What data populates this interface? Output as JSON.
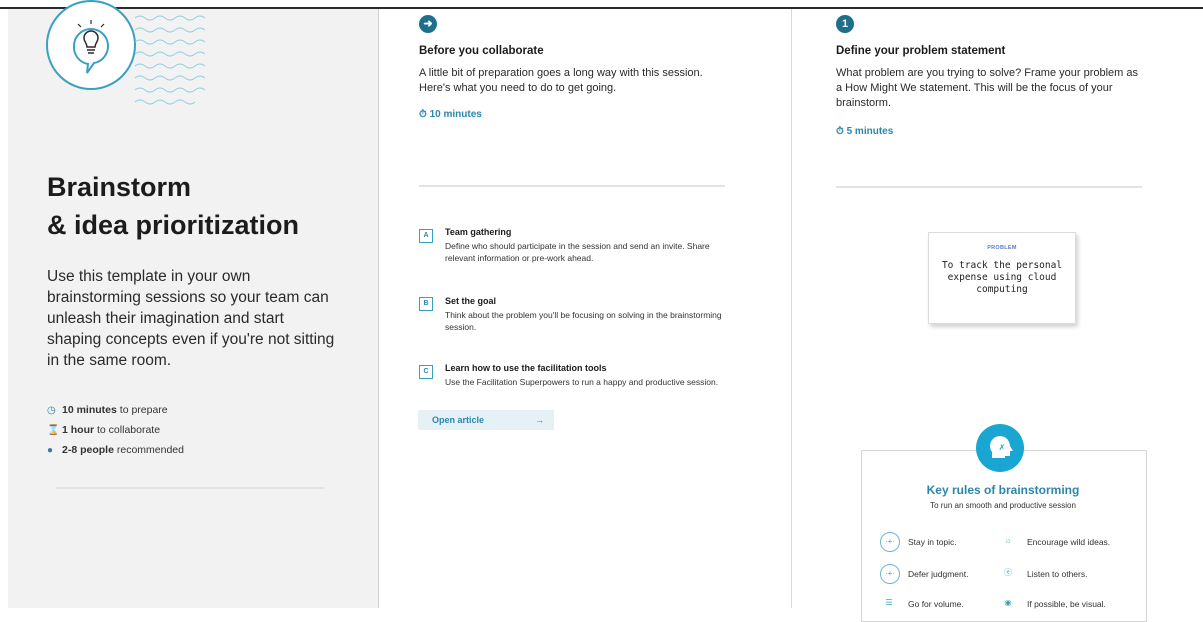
{
  "left": {
    "title_line1": "Brainstorm",
    "title_line2": "& idea prioritization",
    "description": "Use this template in your own brainstorming sessions so your team can unleash their imagination and start shaping concepts even if you're not sitting in the same room.",
    "meta": [
      {
        "icon": "clock-icon",
        "bold": "10 minutes",
        "text": " to prepare"
      },
      {
        "icon": "hourglass-icon",
        "bold": "1 hour",
        "text": " to collaborate"
      },
      {
        "icon": "person-icon",
        "bold": "2-8 people",
        "text": " recommended"
      }
    ]
  },
  "mid": {
    "step_icon": "arrow-right-icon",
    "heading": "Before you collaborate",
    "intro": "A little bit of preparation goes a long way with this session. Here's what you need to do to get going.",
    "time": "10 minutes",
    "items": [
      {
        "letter": "A",
        "title": "Team gathering",
        "text": "Define who should participate in the session and send an invite. Share relevant information or pre-work ahead."
      },
      {
        "letter": "B",
        "title": "Set the goal",
        "text": "Think about the problem you'll be focusing on solving in the brainstorming session."
      },
      {
        "letter": "C",
        "title": "Learn how to use the facilitation tools",
        "text": "Use the Facilitation Superpowers to run a happy and productive session."
      }
    ],
    "button_label": "Open article",
    "button_arrow": "→"
  },
  "right": {
    "step_number": "1",
    "heading": "Define your problem statement",
    "intro": "What problem are you trying to solve? Frame your problem as a How Might We statement. This will be the focus of your brainstorm.",
    "time": "5 minutes",
    "sticky_label": "PROBLEM",
    "sticky_text": "To track the personal expense using cloud computing",
    "rules_title": "Key rules of brainstorming",
    "rules_subtitle": "To run an smooth and productive session",
    "rules": [
      {
        "icon": "target-icon",
        "text": "Stay in topic."
      },
      {
        "icon": "lightbulb-icon",
        "text": "Encourage wild ideas."
      },
      {
        "icon": "pause-icon",
        "text": "Defer judgment."
      },
      {
        "icon": "ear-icon",
        "text": "Listen to others."
      },
      {
        "icon": "stack-icon",
        "text": "Go for volume."
      },
      {
        "icon": "eye-icon",
        "text": "If possible, be visual."
      }
    ]
  },
  "colors": {
    "accent": "#2b86ad",
    "step": "#1f6f8b",
    "badge": "#1aa6d3",
    "left_bg": "#f2f2f2"
  }
}
